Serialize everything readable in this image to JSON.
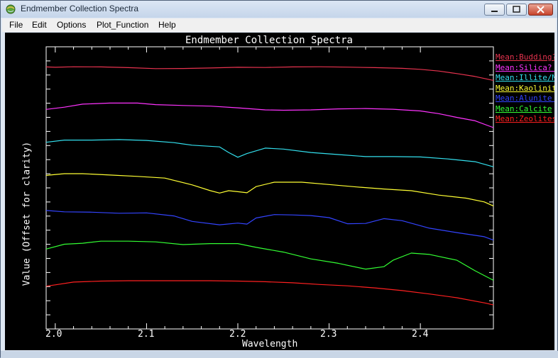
{
  "window": {
    "title": "Endmember Collection Spectra"
  },
  "menu": {
    "items": [
      "File",
      "Edit",
      "Options",
      "Plot_Function",
      "Help"
    ]
  },
  "icons": {
    "app": "envi-globe-icon",
    "minimize": "minimize-icon",
    "maximize": "maximize-icon",
    "close": "close-icon"
  },
  "chart_data": {
    "type": "line",
    "title": "Endmember Collection Spectra",
    "xlabel": "Wavelength",
    "ylabel": "Value (Offset for clarity)",
    "xlim": [
      1.99,
      2.48
    ],
    "x_ticks": [
      "2.0",
      "2.1",
      "2.2",
      "2.3",
      "2.4"
    ],
    "background": "#000000",
    "legend_position": "right",
    "series": [
      {
        "name": "Mean:Budding?",
        "color": "#e8334f",
        "offset": 7,
        "x": [
          1.99,
          2.0,
          2.02,
          2.05,
          2.08,
          2.11,
          2.14,
          2.17,
          2.2,
          2.23,
          2.26,
          2.29,
          2.32,
          2.35,
          2.38,
          2.4,
          2.42,
          2.44,
          2.46,
          2.48
        ],
        "y": [
          0.94,
          0.92,
          0.95,
          0.94,
          0.9,
          0.84,
          0.85,
          0.88,
          0.92,
          0.91,
          0.94,
          0.95,
          0.93,
          0.9,
          0.86,
          0.8,
          0.7,
          0.55,
          0.38,
          0.15
        ]
      },
      {
        "name": "Mean:Silica? (",
        "color": "#ff33ff",
        "offset": 6,
        "x": [
          1.99,
          2.01,
          2.03,
          2.06,
          2.09,
          2.11,
          2.14,
          2.17,
          2.2,
          2.23,
          2.25,
          2.28,
          2.31,
          2.34,
          2.37,
          2.4,
          2.42,
          2.44,
          2.46,
          2.48
        ],
        "y": [
          0.55,
          0.68,
          0.86,
          0.92,
          0.92,
          0.83,
          0.78,
          0.74,
          0.64,
          0.52,
          0.5,
          0.52,
          0.58,
          0.6,
          0.56,
          0.46,
          0.3,
          0.08,
          -0.12,
          -0.52
        ]
      },
      {
        "name": "Mean:Illite/Mu",
        "color": "#33e0ee",
        "offset": 5,
        "x": [
          1.99,
          2.01,
          2.04,
          2.07,
          2.1,
          2.13,
          2.15,
          2.18,
          2.19,
          2.2,
          2.21,
          2.23,
          2.25,
          2.28,
          2.31,
          2.34,
          2.37,
          2.4,
          2.43,
          2.46,
          2.48
        ],
        "y": [
          0.72,
          0.85,
          0.85,
          0.88,
          0.83,
          0.7,
          0.55,
          0.45,
          0.12,
          -0.16,
          0.06,
          0.38,
          0.32,
          0.12,
          0.0,
          -0.12,
          -0.12,
          -0.14,
          -0.26,
          -0.42,
          -0.72
        ]
      },
      {
        "name": "Mean:Kaolinite",
        "color": "#ffff33",
        "offset": 4,
        "x": [
          1.99,
          2.01,
          2.03,
          2.06,
          2.09,
          2.12,
          2.15,
          2.17,
          2.18,
          2.19,
          2.2,
          2.21,
          2.22,
          2.24,
          2.27,
          2.3,
          2.33,
          2.36,
          2.39,
          2.42,
          2.45,
          2.47,
          2.48
        ],
        "y": [
          0.88,
          0.98,
          0.98,
          0.9,
          0.82,
          0.72,
          0.32,
          -0.02,
          -0.16,
          -0.02,
          -0.08,
          -0.14,
          0.22,
          0.48,
          0.48,
          0.34,
          0.2,
          0.08,
          -0.02,
          -0.28,
          -0.46,
          -0.68,
          -0.92
        ]
      },
      {
        "name": "Mean:Alunite ?",
        "color": "#3344ff",
        "offset": 3,
        "x": [
          1.99,
          2.01,
          2.04,
          2.07,
          2.1,
          2.13,
          2.15,
          2.18,
          2.2,
          2.21,
          2.22,
          2.24,
          2.26,
          2.28,
          2.3,
          2.32,
          2.34,
          2.36,
          2.38,
          2.41,
          2.44,
          2.47,
          2.48
        ],
        "y": [
          0.92,
          0.84,
          0.82,
          0.76,
          0.78,
          0.6,
          0.28,
          0.08,
          0.18,
          0.12,
          0.48,
          0.68,
          0.66,
          0.62,
          0.5,
          0.14,
          0.16,
          0.44,
          0.32,
          -0.12,
          -0.38,
          -0.62,
          -0.82
        ]
      },
      {
        "name": "Mean:Calcite",
        "color": "#33ff33",
        "offset": 2,
        "x": [
          1.99,
          2.01,
          2.03,
          2.05,
          2.08,
          2.11,
          2.14,
          2.17,
          2.2,
          2.22,
          2.25,
          2.28,
          2.31,
          2.34,
          2.36,
          2.37,
          2.39,
          2.41,
          2.44,
          2.46,
          2.48
        ],
        "y": [
          0.76,
          1.04,
          1.1,
          1.22,
          1.22,
          1.18,
          1.02,
          1.08,
          1.08,
          0.86,
          0.58,
          0.18,
          -0.08,
          -0.42,
          -0.28,
          0.1,
          0.52,
          0.44,
          0.1,
          -0.52,
          -1.08
        ]
      },
      {
        "name": "Mean:Zeolites",
        "color": "#ff2020",
        "offset": 1,
        "x": [
          1.99,
          2.0,
          2.02,
          2.05,
          2.08,
          2.11,
          2.14,
          2.17,
          2.2,
          2.23,
          2.26,
          2.29,
          2.32,
          2.35,
          2.38,
          2.41,
          2.44,
          2.47,
          2.48
        ],
        "y": [
          0.68,
          0.76,
          0.92,
          0.98,
          1.0,
          1.0,
          1.0,
          1.0,
          0.98,
          0.94,
          0.88,
          0.78,
          0.7,
          0.58,
          0.42,
          0.22,
          0.0,
          -0.3,
          -0.42
        ]
      }
    ]
  }
}
